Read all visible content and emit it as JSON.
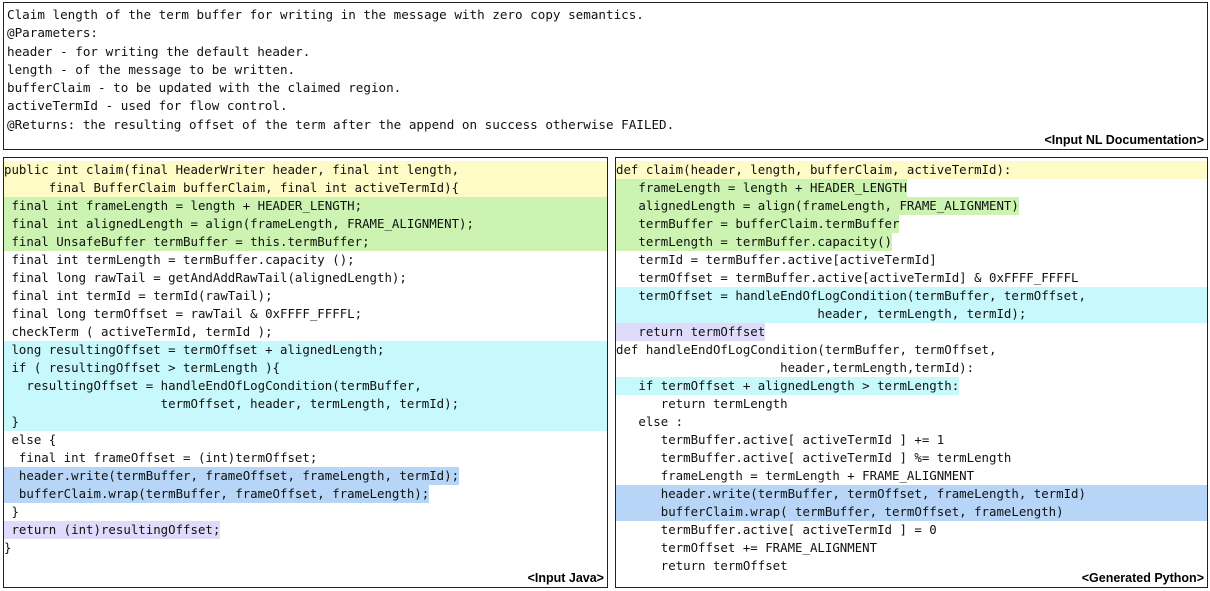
{
  "colors": {
    "yellow": "#fffbc6",
    "green": "#ccf3b2",
    "cyan": "#c7f8fb",
    "lavender": "#dedcfa",
    "blue": "#b7d6f7"
  },
  "doc": {
    "tag": "<Input NL Documentation>",
    "lines": [
      "Claim length of the term buffer for writing in the message with zero copy semantics.",
      "@Parameters:",
      "header - for writing the default header.",
      "length - of the message to be written.",
      "bufferClaim - to be updated with the claimed region.",
      "activeTermId - used for flow control.",
      "@Returns: the resulting offset of the term after the append on success otherwise FAILED."
    ]
  },
  "java": {
    "tag": "<Input Java>",
    "lines": [
      {
        "text": "public int claim(final HeaderWriter header, final int length,",
        "hl": "yellow",
        "full": true
      },
      {
        "text": "      final BufferClaim bufferClaim, final int activeTermId){",
        "hl": "yellow",
        "full": true
      },
      {
        "text": " final int frameLength = length + HEADER_LENGTH;",
        "hl": "green",
        "full": true
      },
      {
        "text": " final int alignedLength = align(frameLength, FRAME_ALIGNMENT);",
        "hl": "green",
        "full": true
      },
      {
        "text": " final UnsafeBuffer termBuffer = this.termBuffer;",
        "hl": "green",
        "full": true
      },
      {
        "text": " final int termLength = termBuffer.capacity ();",
        "hl": "",
        "full": false
      },
      {
        "text": " final long rawTail = getAndAddRawTail(alignedLength);",
        "hl": "",
        "full": false
      },
      {
        "text": " final int termId = termId(rawTail);",
        "hl": "",
        "full": false
      },
      {
        "text": " final long termOffset = rawTail & 0xFFFF_FFFFL;",
        "hl": "",
        "full": false
      },
      {
        "text": " checkTerm ( activeTermId, termId );",
        "hl": "",
        "full": false
      },
      {
        "text": " long resultingOffset = termOffset + alignedLength;",
        "hl": "cyan",
        "full": true
      },
      {
        "text": " if ( resultingOffset > termLength ){",
        "hl": "cyan",
        "full": true
      },
      {
        "text": "   resultingOffset = handleEndOfLogCondition(termBuffer,",
        "hl": "cyan",
        "full": true
      },
      {
        "text": "                     termOffset, header, termLength, termId);",
        "hl": "cyan",
        "full": true
      },
      {
        "text": " }",
        "hl": "cyan",
        "full": true
      },
      {
        "text": " else {",
        "hl": "",
        "full": false
      },
      {
        "text": "  final int frameOffset = (int)termOffset;",
        "hl": "",
        "full": false
      },
      {
        "text": "  header.write(termBuffer, frameOffset, frameLength, termId);",
        "hl": "blue",
        "full": false
      },
      {
        "text": "  bufferClaim.wrap(termBuffer, frameOffset, frameLength);",
        "hl": "blue",
        "full": false
      },
      {
        "text": " }",
        "hl": "",
        "full": false
      },
      {
        "text": " return (int)resultingOffset;",
        "hl": "lavender",
        "full": false
      },
      {
        "text": "}",
        "hl": "",
        "full": false
      }
    ]
  },
  "python": {
    "tag": "<Generated Python>",
    "lines": [
      {
        "text": "def claim(header, length, bufferClaim, activeTermId):",
        "hl": "yellow",
        "full": true
      },
      {
        "text": "   frameLength = length + HEADER_LENGTH",
        "hl": "green",
        "full": false
      },
      {
        "text": "   alignedLength = align(frameLength, FRAME_ALIGNMENT)",
        "hl": "green",
        "full": false
      },
      {
        "text": "   termBuffer = bufferClaim.termBuffer",
        "hl": "green",
        "full": false
      },
      {
        "text": "   termLength = termBuffer.capacity()",
        "hl": "green",
        "full": false
      },
      {
        "text": "   termId = termBuffer.active[activeTermId]",
        "hl": "",
        "full": false
      },
      {
        "text": "   termOffset = termBuffer.active[activeTermId] & 0xFFFF_FFFFL",
        "hl": "",
        "full": false
      },
      {
        "text": "   termOffset = handleEndOfLogCondition(termBuffer, termOffset,",
        "hl": "cyan",
        "full": true
      },
      {
        "text": "                           header, termLength, termId);",
        "hl": "cyan",
        "full": true
      },
      {
        "text": "   return termOffset",
        "hl": "lavender",
        "full": false
      },
      {
        "text": "def handleEndOfLogCondition(termBuffer, termOffset,",
        "hl": "",
        "full": false
      },
      {
        "text": "                      header,termLength,termId):",
        "hl": "",
        "full": false
      },
      {
        "text": "   if termOffset + alignedLength > termLength:",
        "hl": "cyan",
        "full": false
      },
      {
        "text": "      return termLength",
        "hl": "",
        "full": false
      },
      {
        "text": "   else :",
        "hl": "",
        "full": false
      },
      {
        "text": "      termBuffer.active[ activeTermId ] += 1",
        "hl": "",
        "full": false
      },
      {
        "text": "      termBuffer.active[ activeTermId ] %= termLength",
        "hl": "",
        "full": false
      },
      {
        "text": "      frameLength = termLength + FRAME_ALIGNMENT",
        "hl": "",
        "full": false
      },
      {
        "text": "      header.write(termBuffer, termOffset, frameLength, termId)",
        "hl": "blue",
        "full": true
      },
      {
        "text": "      bufferClaim.wrap( termBuffer, termOffset, frameLength)",
        "hl": "blue",
        "full": true
      },
      {
        "text": "      termBuffer.active[ activeTermId ] = 0",
        "hl": "",
        "full": false
      },
      {
        "text": "      termOffset += FRAME_ALIGNMENT",
        "hl": "",
        "full": false
      },
      {
        "text": "      return termOffset",
        "hl": "",
        "full": false
      }
    ]
  }
}
